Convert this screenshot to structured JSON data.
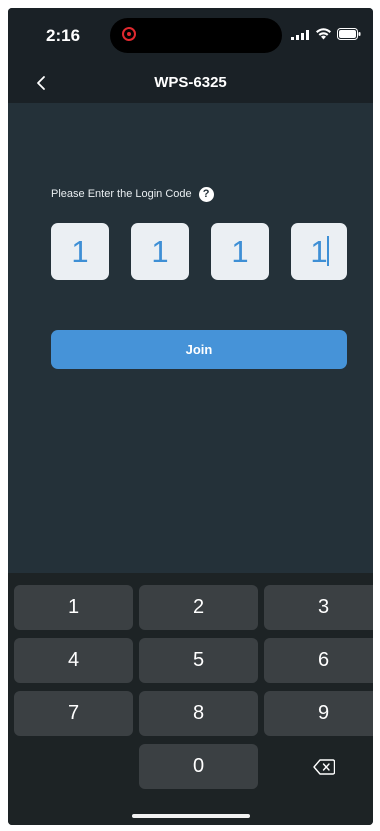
{
  "status_bar": {
    "time": "2:16",
    "icons": [
      "recording-icon",
      "signal-icon",
      "wifi-icon",
      "battery-icon"
    ]
  },
  "nav": {
    "back_icon": "chevron-left-icon",
    "title": "WPS-6325"
  },
  "login": {
    "prompt": "Please Enter the Login Code",
    "help_icon": "question-circle-icon",
    "help_glyph": "?",
    "code_digits": [
      "1",
      "1",
      "1",
      "1"
    ],
    "join_label": "Join"
  },
  "keypad": {
    "keys": [
      "1",
      "2",
      "3",
      "4",
      "5",
      "6",
      "7",
      "8",
      "9",
      "0"
    ],
    "delete_icon": "backspace-icon"
  },
  "colors": {
    "background": "#243139",
    "accent": "#4693d8",
    "digit": "#3e8fd5",
    "code_box": "#ebeff3",
    "keypad_bg": "#1d2325",
    "key_bg": "#3b4043",
    "recording": "#e0292f"
  }
}
